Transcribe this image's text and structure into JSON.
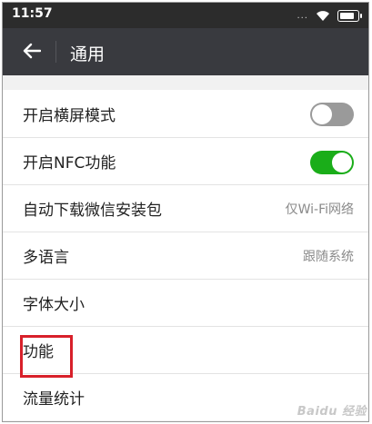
{
  "statusbar": {
    "time": "11:57",
    "dots": "...",
    "battery_level": 0.85
  },
  "header": {
    "title": "通用"
  },
  "settings": [
    {
      "label": "开启横屏模式",
      "toggle": "off"
    },
    {
      "label": "开启NFC功能",
      "toggle": "on"
    },
    {
      "label": "自动下载微信安装包",
      "value": "仅Wi-Fi网络"
    },
    {
      "label": "多语言",
      "value": "跟随系统"
    },
    {
      "label": "字体大小"
    },
    {
      "label": "功能"
    },
    {
      "label": "流量统计"
    }
  ],
  "annotation": {
    "highlight_color": "#d8202a",
    "highlighted_item": "功能"
  },
  "colors": {
    "toggle_on": "#1aad19",
    "toggle_off": "#9a9a9a",
    "titlebar": "#393a3f"
  },
  "watermark": "Baidu 经验"
}
